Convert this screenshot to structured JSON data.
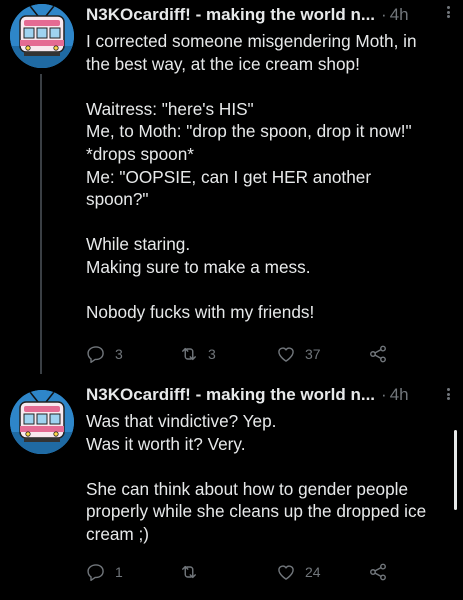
{
  "colors": {
    "background": "#000000",
    "text": "#e7e9ea",
    "muted": "#71767b",
    "avatar_bg": "#2e86c9"
  },
  "tweets": [
    {
      "author": "N3KOcardiff! - making the world n...",
      "separator": "·",
      "time": "4h",
      "lines": [
        "I corrected someone misgendering Moth, in",
        "the best way, at the ice cream shop!",
        "",
        "Waitress: \"here's HIS\"",
        "Me, to Moth: \"drop the spoon, drop it now!\"",
        "*drops spoon*",
        "Me: \"OOPSIE, can I get HER another",
        "spoon?\"",
        "",
        "While staring.",
        "Making sure to make a mess.",
        "",
        "Nobody fucks with my friends!"
      ],
      "replies": "3",
      "retweets": "3",
      "likes": "37"
    },
    {
      "author": "N3KOcardiff! - making the world n...",
      "separator": "·",
      "time": "4h",
      "lines": [
        "Was that vindictive? Yep.",
        "Was it worth it? Very.",
        "",
        "She can think about how to gender people",
        "properly while she cleans up the dropped ice",
        "cream ;)"
      ],
      "replies": "1",
      "retweets": "",
      "likes": "24"
    }
  ],
  "icons": {
    "avatar": "tram-illustration",
    "more": "more-vertical-icon",
    "reply": "reply-icon",
    "retweet": "retweet-icon",
    "like": "heart-icon",
    "share": "share-icon"
  }
}
